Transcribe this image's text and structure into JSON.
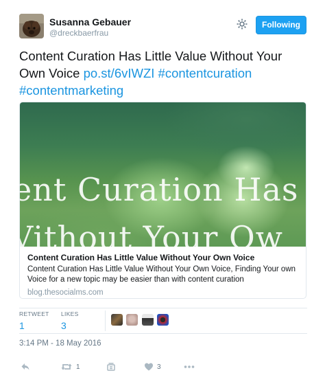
{
  "user": {
    "name": "Susanna Gebauer",
    "handle": "@dreckbaerfrau"
  },
  "follow_button": {
    "label": "Following"
  },
  "tweet": {
    "text": "Content Curation Has Little Value Without Your Own Voice",
    "link": "po.st/6vIWZI",
    "hashtag1": "#contentcuration",
    "hashtag2": "#contentmarketing"
  },
  "card": {
    "image_line1": "ent Curation Has",
    "image_line2": "Vithout Your Ow",
    "title": "Content Curation Has Little Value Without Your Own Voice",
    "description": "Content Curation Has Little Value Without Your Own Voice, Finding Your own Voice for a new topic may be easier than with content curation",
    "domain": "blog.thesocialms.com"
  },
  "stats": {
    "retweets_label": "RETWEET",
    "retweets_value": "1",
    "likes_label": "LIKES",
    "likes_value": "3"
  },
  "timestamp": "3:14 PM - 18 May 2016",
  "actions": {
    "reply_icon": "reply-icon",
    "retweet_icon": "retweet-icon",
    "retweet_count": "1",
    "stack_icon": "stack-icon",
    "like_icon": "heart-icon",
    "like_count": "3",
    "more_icon": "more-icon"
  },
  "colors": {
    "accent": "#1da1f2",
    "link": "#1b95e0"
  }
}
